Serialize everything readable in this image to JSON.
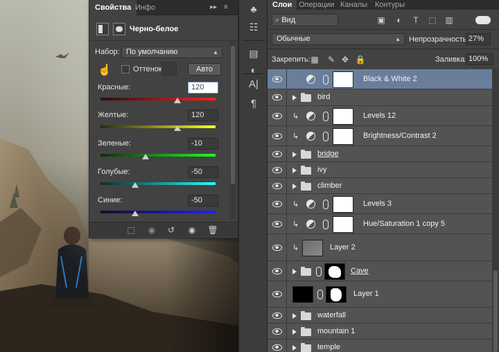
{
  "properties": {
    "tabs": [
      {
        "label": "Свойства"
      },
      {
        "label": "Инфо"
      }
    ],
    "title": "Черно-белое",
    "preset_label": "Набор:",
    "preset_value": "По умолчанию",
    "tint_label": "Оттенок",
    "auto_label": "Авто",
    "sliders": [
      {
        "label": "Красные:",
        "value": "120",
        "level": 0.67,
        "gradient": "linear-gradient(90deg,#2a1010,#ff2020)"
      },
      {
        "label": "Желтые:",
        "value": "120",
        "level": 0.67,
        "gradient": "linear-gradient(90deg,#2a2a10,#ffff20)"
      },
      {
        "label": "Зеленые:",
        "value": "-10",
        "level": 0.39,
        "gradient": "linear-gradient(90deg,#102a10,#20ff20)"
      },
      {
        "label": "Голубые:",
        "value": "-50",
        "level": 0.3,
        "gradient": "linear-gradient(90deg,#102a2a,#20ffff)"
      },
      {
        "label": "Синие:",
        "value": "-50",
        "level": 0.3,
        "gradient": "linear-gradient(90deg,#10102a,#2020ff)"
      }
    ]
  },
  "layers_panel": {
    "tabs": [
      {
        "label": "Слои"
      },
      {
        "label": "Операции"
      },
      {
        "label": "Каналы"
      },
      {
        "label": "Контуры"
      }
    ],
    "filter_kind": "Вид",
    "blend_mode": "Обычные",
    "opacity_label": "Непрозрачность:",
    "opacity_value": "27%",
    "lock_label": "Закрепить:",
    "fill_label": "Заливка:",
    "fill_value": "100%",
    "layers": [
      {
        "name": "Black & White 2",
        "kind": "adjustment",
        "selected": true
      },
      {
        "name": "bird",
        "kind": "group"
      },
      {
        "name": "Levels 12",
        "kind": "adjustment",
        "clipped": true
      },
      {
        "name": "Brightness/Contrast 2",
        "kind": "adjustment",
        "clipped": true
      },
      {
        "name": "bridge",
        "kind": "group",
        "underline": true
      },
      {
        "name": "ivy",
        "kind": "group"
      },
      {
        "name": "climber",
        "kind": "group"
      },
      {
        "name": "Levels 3",
        "kind": "adjustment",
        "clipped": true
      },
      {
        "name": "Hue/Saturation 1 copy 5",
        "kind": "adjustment",
        "clipped": true
      },
      {
        "name": "Layer 2",
        "kind": "pixel",
        "clipped": true
      },
      {
        "name": "Cave",
        "kind": "group-mask",
        "underline": true
      },
      {
        "name": "Layer 1",
        "kind": "pixel-mask"
      },
      {
        "name": "waterfall",
        "kind": "group"
      },
      {
        "name": "mountain 1",
        "kind": "group"
      },
      {
        "name": "temple",
        "kind": "group"
      }
    ]
  }
}
